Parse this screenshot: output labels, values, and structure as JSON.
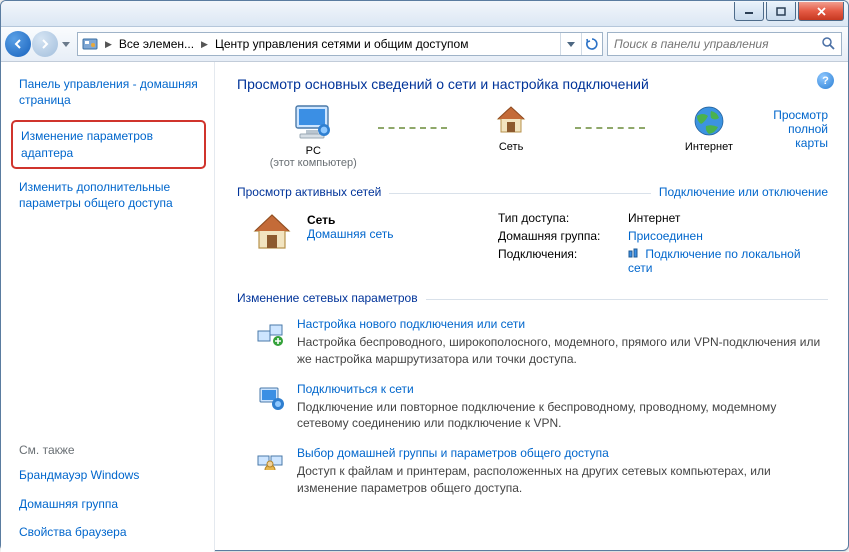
{
  "toolbar": {
    "breadcrumb1": "Все элемен...",
    "breadcrumb2": "Центр управления сетями и общим доступом",
    "search_placeholder": "Поиск в панели управления"
  },
  "sidebar": {
    "home": "Панель управления - домашняя страница",
    "adapter": "Изменение параметров адаптера",
    "advanced": "Изменить дополнительные параметры общего доступа",
    "see_also": "См. также",
    "firewall": "Брандмауэр Windows",
    "homegroup": "Домашняя группа",
    "browser": "Свойства браузера"
  },
  "main": {
    "title": "Просмотр основных сведений о сети и настройка подключений",
    "map": {
      "pc": "PC",
      "pc_sub": "(этот компьютер)",
      "net": "Сеть",
      "internet": "Интернет",
      "full_map": "Просмотр полной карты"
    },
    "active": {
      "hdr": "Просмотр активных сетей",
      "toggle": "Подключение или отключение",
      "net_name": "Сеть",
      "net_type": "Домашняя сеть",
      "k_access": "Тип доступа:",
      "v_access": "Интернет",
      "k_hg": "Домашняя группа:",
      "v_hg": "Присоединен",
      "k_conn": "Подключения:",
      "v_conn": "Подключение по локальной сети"
    },
    "change": {
      "hdr": "Изменение сетевых параметров",
      "s1t": "Настройка нового подключения или сети",
      "s1d": "Настройка беспроводного, широкополосного, модемного, прямого или VPN-подключения или же настройка маршрутизатора или точки доступа.",
      "s2t": "Подключиться к сети",
      "s2d": "Подключение или повторное подключение к беспроводному, проводному, модемному сетевому соединению или подключение к VPN.",
      "s3t": "Выбор домашней группы и параметров общего доступа",
      "s3d": "Доступ к файлам и принтерам, расположенных на других сетевых компьютерах, или изменение параметров общего доступа."
    }
  }
}
